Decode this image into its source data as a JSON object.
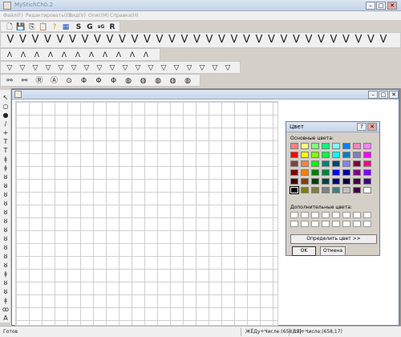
{
  "window": {
    "title": "MyStichCh0.2",
    "min": "–",
    "max": "□",
    "close": "✕"
  },
  "menu": [
    "Файл(F)",
    "Редактировать(E)",
    "Вид(V)",
    "Опис(M)",
    "Справка(H)"
  ],
  "toolbar1": {
    "items": [
      "🗋",
      "💾",
      "⎘",
      "📋",
      "?",
      "▦",
      "S",
      "G",
      "sG",
      "R"
    ]
  },
  "stitch_row1": [
    "V",
    "V",
    "V",
    "V",
    "V",
    "V",
    "V",
    "V",
    "V",
    "V",
    "V",
    "V",
    "V",
    "V",
    "V",
    "V",
    "V",
    "V",
    "V",
    "V",
    "V",
    "V",
    "V",
    "V",
    "V",
    "V",
    "V",
    "V",
    "V",
    "V",
    "V"
  ],
  "stitch_row2": [
    "Λ",
    "Λ",
    "Λ",
    "Λ",
    "Λ",
    "Λ",
    "Λ",
    "Λ",
    "Λ",
    "Λ",
    "Λ"
  ],
  "stitch_row3": [
    "▽",
    "▽",
    "▽",
    "▽",
    "▽",
    "▽",
    "▽",
    "▽",
    "▽",
    "▽",
    "▽",
    "▽",
    "▽",
    "▽",
    "▽",
    "▽",
    "▽",
    "▽"
  ],
  "stitch_row4": [
    "⚯",
    "⚯",
    "Ⓡ",
    "Ⓐ",
    "⊙",
    "Φ",
    "Φ",
    "Φ",
    "◍",
    "◍",
    "◍",
    "◍",
    "◍"
  ],
  "left_tools": [
    "↖",
    "○",
    "●",
    "/",
    "+",
    "T",
    "T",
    "ǂ",
    "ǂ",
    "ȣ",
    "ȣ",
    "ȣ",
    "ȣ",
    "ȣ",
    "ȣ",
    "ȣ",
    "ȣ",
    "ȣ",
    "ȣ",
    "ȣ",
    "ǂ",
    "ȣ",
    "ȣ",
    "ǂ",
    "ꝏ",
    "A"
  ],
  "child": {
    "min": "–",
    "max": "□",
    "close": "✕"
  },
  "dialog": {
    "title": "Цвет",
    "help": "?",
    "close": "✕",
    "basic_label": "Основные цвета:",
    "custom_label": "Дополнительные цвета:",
    "define_button": "Определить цвет >>",
    "ok": "OK",
    "cancel": "Отмена",
    "basic_colors": [
      "#ff8080",
      "#ffff80",
      "#80ff80",
      "#00ff80",
      "#80ffff",
      "#0080ff",
      "#ff80c0",
      "#ff80ff",
      "#ff0000",
      "#ffff00",
      "#80ff00",
      "#00ff40",
      "#00ffff",
      "#0080c0",
      "#8080c0",
      "#ff00ff",
      "#804040",
      "#ff8040",
      "#00ff00",
      "#008080",
      "#004080",
      "#8080ff",
      "#800040",
      "#ff0080",
      "#800000",
      "#ff8000",
      "#008000",
      "#008040",
      "#0000ff",
      "#0000a0",
      "#800080",
      "#8000ff",
      "#400000",
      "#804000",
      "#004000",
      "#004040",
      "#000080",
      "#000040",
      "#400040",
      "#400080",
      "#000000",
      "#808000",
      "#808040",
      "#808080",
      "#408080",
      "#c0c0c0",
      "#400040",
      "#ffffff"
    ],
    "selected_index": 40
  },
  "status": {
    "ready": "Готов",
    "coord1": "ЖЁДу+Числе:(658,17)",
    "coord2": "ВЯ|+Числе:(658,17)"
  }
}
